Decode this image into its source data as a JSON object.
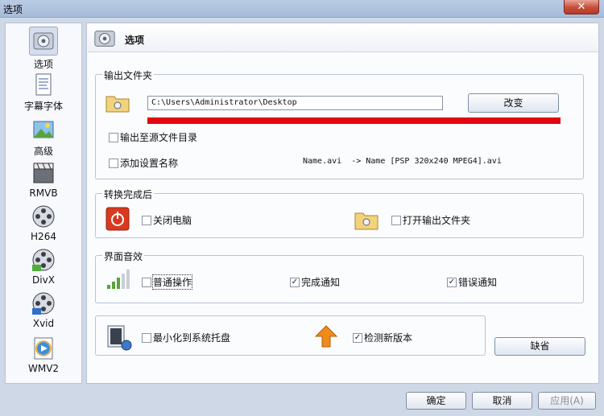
{
  "window": {
    "title": "选项",
    "close_glyph": "✕"
  },
  "sidebar": {
    "items": [
      {
        "label": "选项",
        "icon": "options-icon",
        "active": true
      },
      {
        "label": "字幕字体",
        "icon": "subtitle-font-icon"
      },
      {
        "label": "高级",
        "icon": "advanced-icon"
      },
      {
        "label": "RMVB",
        "icon": "rmvb-icon"
      },
      {
        "label": "H264",
        "icon": "film-reel-icon"
      },
      {
        "label": "DivX",
        "icon": "film-reel-icon"
      },
      {
        "label": "Xvid",
        "icon": "film-reel-icon"
      },
      {
        "label": "WMV2",
        "icon": "wmv-icon"
      }
    ]
  },
  "header": {
    "title": "选项"
  },
  "output_folder": {
    "label": "输出文件夹",
    "path": "C:\\Users\\Administrator\\Desktop",
    "change_button": "改变",
    "output_to_source": "输出至源文件目录",
    "add_setting_name": "添加设置名称",
    "name_example": "Name.avi  -> Name [PSP 320x240 MPEG4].avi"
  },
  "after_convert": {
    "label": "转换完成后",
    "shutdown": "关闭电脑",
    "open_folder": "打开输出文件夹"
  },
  "ui_sound": {
    "label": "界面音效",
    "normal_op": "普通操作",
    "done_notify": "完成通知",
    "error_notify": "错误通知"
  },
  "misc": {
    "minimize_tray": "最小化到系统托盘",
    "check_update": "检测新版本",
    "default_button": "缺省"
  },
  "footer": {
    "ok": "确定",
    "cancel": "取消",
    "apply": "应用(A)"
  },
  "colors": {
    "accent_red": "#e30613",
    "shutdown_red": "#d9391f",
    "arrow_orange": "#f08a1c"
  }
}
